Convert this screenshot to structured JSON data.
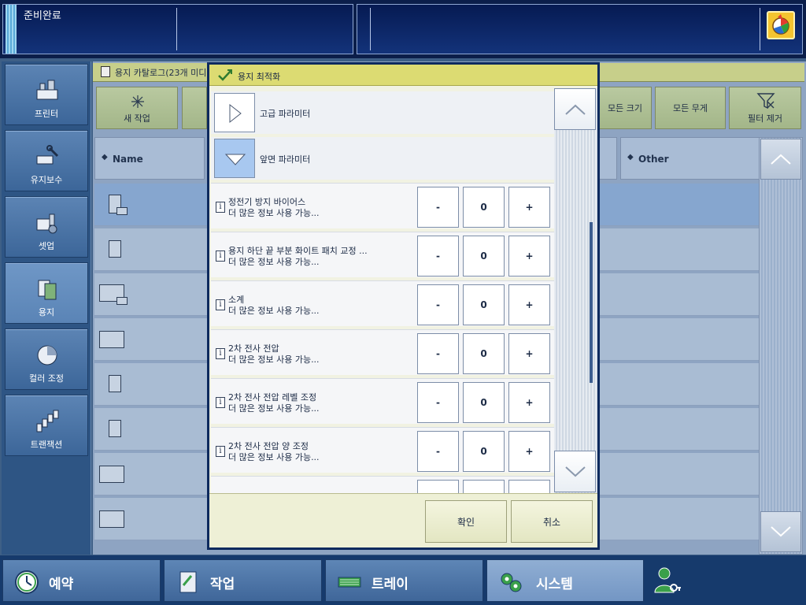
{
  "top": {
    "status": "준비완료"
  },
  "nav": [
    {
      "label": "프린터",
      "icon": "printer-icon"
    },
    {
      "label": "유지보수",
      "icon": "maintenance-icon"
    },
    {
      "label": "셋업",
      "icon": "setup-icon"
    },
    {
      "label": "용지",
      "icon": "paper-icon"
    },
    {
      "label": "컬러 조정",
      "icon": "color-adjust-icon"
    },
    {
      "label": "트랜잭션",
      "icon": "transaction-icon"
    }
  ],
  "catalog": {
    "title": "용지 카탈로그(23개 미디",
    "new_job": "새 작업",
    "all_sizes": "모든 크기",
    "all_weights": "모든 무게",
    "clear_filter": "필터 제거",
    "col_name": "Name",
    "col_other": "Other"
  },
  "dialog": {
    "title": "용지 최적화",
    "sections": [
      {
        "label": "고급 파라미터"
      },
      {
        "label": "앞면 파라미터"
      }
    ],
    "params": [
      {
        "name": "정전기 방지 바이어스",
        "more": "더 많은 정보 사용 가능...",
        "value": "0"
      },
      {
        "name": "용지 하단 끝 부분 화이트 패치 교정 ...",
        "more": "더 많은 정보 사용 가능...",
        "value": "0"
      },
      {
        "name": "소계",
        "more": "더 많은 정보 사용 가능...",
        "value": "0"
      },
      {
        "name": "2차 전사 전압",
        "more": "더 많은 정보 사용 가능...",
        "value": "0"
      },
      {
        "name": "2차 전사 전압 레벨 조정",
        "more": "더 많은 정보 사용 가능...",
        "value": "0"
      },
      {
        "name": "2차 전사 전압 양 조정",
        "more": "더 많은 정보 사용 가능...",
        "value": "0"
      }
    ],
    "minus": "-",
    "plus": "+",
    "info": "i",
    "ok": "확인",
    "cancel": "취소"
  },
  "bottom": [
    {
      "label": "예약",
      "icon": "clock-icon"
    },
    {
      "label": "작업",
      "icon": "job-icon"
    },
    {
      "label": "트레이",
      "icon": "tray-icon"
    },
    {
      "label": "시스템",
      "icon": "system-gear-icon"
    }
  ]
}
